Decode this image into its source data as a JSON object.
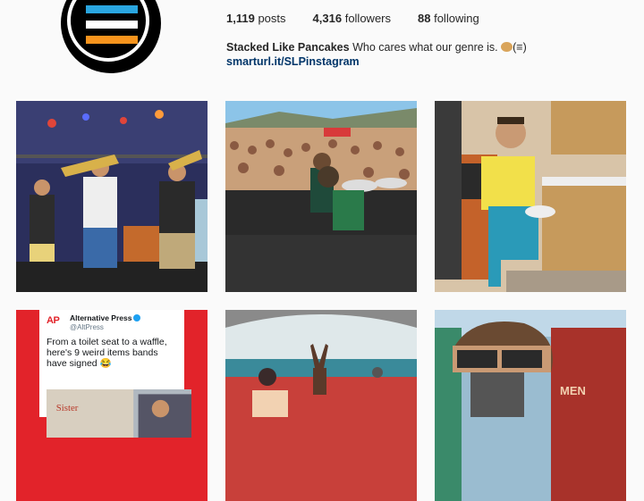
{
  "profile": {
    "avatar_icon": "stacked-stripes-logo",
    "colors": {
      "stripe_top": "#2aa6e0",
      "stripe_middle": "#ffffff",
      "stripe_bottom": "#f7941d"
    }
  },
  "stats": {
    "posts_count": "1,119",
    "posts_label": "posts",
    "followers_count": "4,316",
    "followers_label": "followers",
    "following_count": "88",
    "following_label": "following"
  },
  "bio": {
    "name": "Stacked Like Pancakes",
    "text": "Who cares what our genre is.",
    "trailing": "(≡)",
    "link": "smarturl.it/SLPinstagram"
  },
  "tweet": {
    "logo": "AP",
    "account_name": "Alternative Press",
    "handle": "@AltPress",
    "text": "From a toilet seat to a waffle, here's 9 weird items bands have signed 😂"
  },
  "grid_posts": [
    {
      "content": "band-playing-trombones-on-stage"
    },
    {
      "content": "drummer-performing-to-festival-crowd"
    },
    {
      "content": "man-in-yellow-shirt-with-pancakes"
    },
    {
      "content": "alternative-press-tweet-screenshot"
    },
    {
      "content": "singer-with-arms-raised-festival"
    },
    {
      "content": "person-with-sunglasses-mural"
    }
  ]
}
